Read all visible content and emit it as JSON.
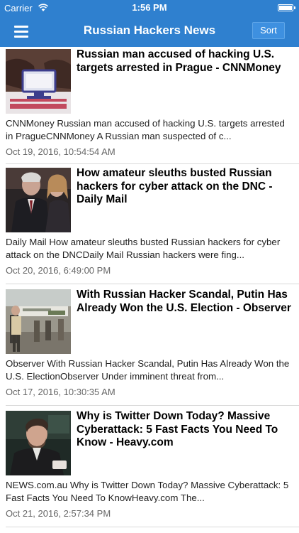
{
  "status_bar": {
    "carrier": "Carrier",
    "time": "1:56 PM",
    "battery_level": 1.0
  },
  "nav": {
    "title": "Russian Hackers News",
    "sort_label": "Sort",
    "menu_icon": "hamburger-menu-icon",
    "bar_color": "#2f80cf"
  },
  "articles": [
    {
      "headline": "Russian man accused of hacking U.S. targets arrested in Prague - CNNMoney",
      "snippet": "CNNMoney    Russian man accused of hacking U.S. targets arrested in PragueCNNMoney  A Russian man suspected of c...",
      "date": "Oct 19, 2016, 10:54:54 AM"
    },
    {
      "headline": "How amateur sleuths busted Russian hackers for cyber attack on the DNC - Daily Mail",
      "snippet": "Daily Mail    How amateur sleuths busted Russian hackers for cyber attack on the DNCDaily Mail  Russian hackers were fing...",
      "date": "Oct 20, 2016, 6:49:00 PM"
    },
    {
      "headline": "With Russian Hacker Scandal, Putin Has Already Won the U.S. Election - Observer",
      "snippet": "Observer    With Russian Hacker Scandal, Putin Has Already Won the U.S. ElectionObserver  Under imminent threat from...",
      "date": "Oct 17, 2016, 10:30:35 AM"
    },
    {
      "headline": "Why is Twitter Down Today? Massive Cyberattack: 5 Fast Facts You Need To Know - Heavy.com",
      "snippet": "NEWS.com.au    Why is Twitter Down Today? Massive Cyberattack: 5 Fast Facts You Need To KnowHeavy.com  The...",
      "date": "Oct 21, 2016, 2:57:34 PM"
    }
  ]
}
